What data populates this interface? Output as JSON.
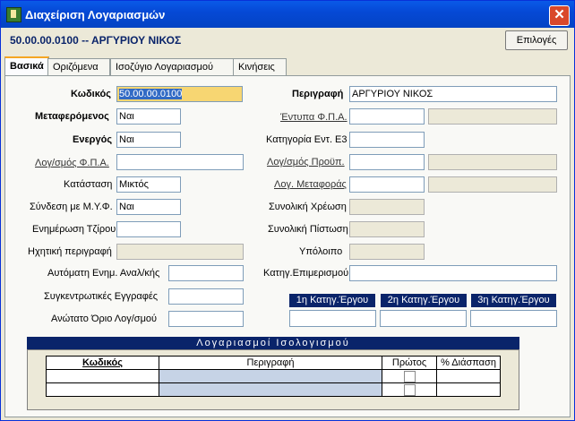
{
  "window": {
    "title": "Διαχείριση Λογαριασμών",
    "close": "✕"
  },
  "header": {
    "account_line": "50.00.00.0100 -- ΑΡΓΥΡΙΟΥ ΝΙΚΟΣ",
    "options_label": "Επιλογές"
  },
  "tabs": [
    "Βασικά",
    "Οριζόμενα",
    "Ισοζύγιο Λογαριασμού",
    "Κινήσεις"
  ],
  "left": {
    "code_label": "Κωδικός",
    "code_value": "50.00.00.0100",
    "carried_label": "Μεταφερόμενος",
    "carried_value": "Ναι",
    "active_label": "Ενεργός",
    "active_value": "Ναι",
    "vat_account_label": "Λογ/σμός Φ.Π.Α.",
    "vat_account_value": "",
    "status_label": "Κατάσταση",
    "status_value": "Μικτός",
    "myf_label": "Σύνδεση με Μ.Υ.Φ.",
    "myf_value": "Ναι",
    "turnover_label": "Ενημέρωση Τζίρου",
    "turnover_value": "",
    "audio_label": "Ηχητική περιγραφή",
    "audio_value": "",
    "auto_update_label": "Αυτόματη Ενημ. Αναλ/κής",
    "auto_update_value": "",
    "summary_label": "Συγκεντρωτικές Εγγραφές",
    "summary_value": "",
    "max_limit_label": "Ανώτατο Όριο Λογ/σμού",
    "max_limit_value": ""
  },
  "right": {
    "description_label": "Περιγραφή",
    "description_value": "ΑΡΓΥΡΙΟΥ ΝΙΚΟΣ",
    "vat_forms_label": "Έντυπα Φ.Π.Α.",
    "e3_label": "Κατηγορία Εντ. Ε3",
    "budget_label": "Λογ/σμός Προϋπ.",
    "transfer_label": "Λογ. Μεταφοράς",
    "debit_label": "Συνολική Χρέωση",
    "credit_label": "Συνολική Πίστωση",
    "balance_label": "Υπόλοιπο",
    "allocation_label": "Κατηγ.Επιμερισμού",
    "categories": [
      "1η Κατηγ.Έργου",
      "2η Κατηγ.Έργου",
      "3η Κατηγ.Έργου"
    ]
  },
  "grid": {
    "title": "Λογαριασμοί Ισολογισμού",
    "columns": [
      "Κωδικός",
      "Περιγραφή",
      "Πρώτος",
      "% Διάσπαση"
    ]
  }
}
